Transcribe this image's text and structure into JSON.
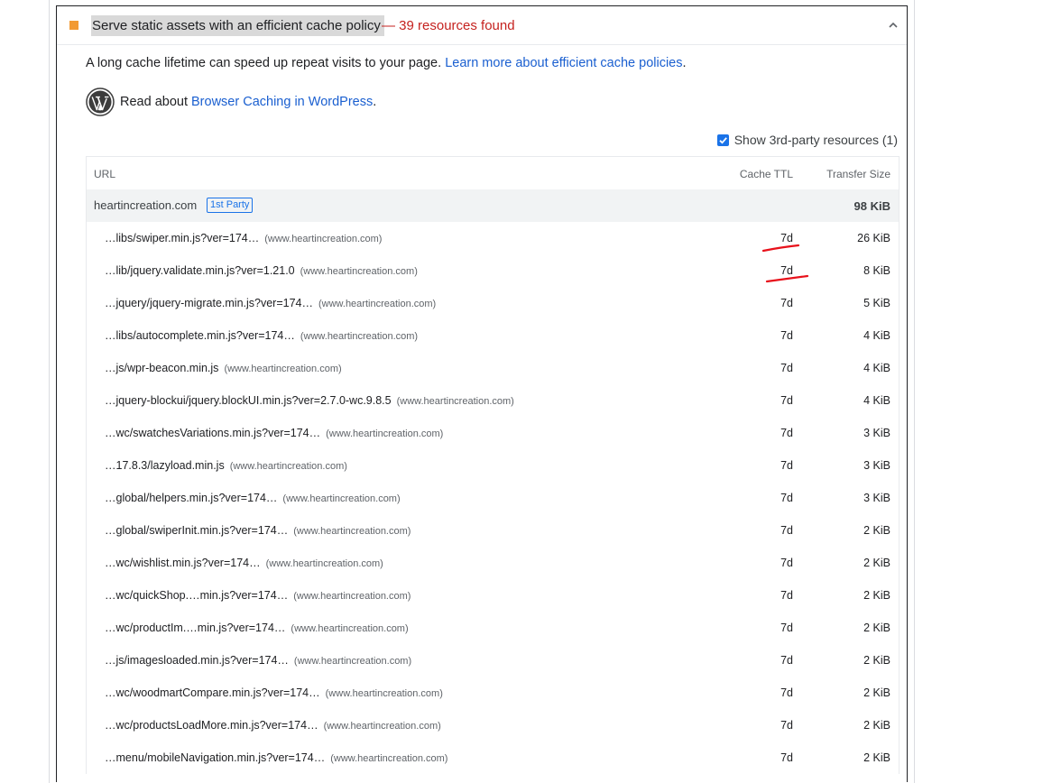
{
  "audit": {
    "title": "Serve static assets with an efficient cache policy",
    "summary": "— 39 resources found",
    "description_text": "A long cache lifetime can speed up repeat visits to your page. ",
    "description_link": "Learn more about efficient cache policies",
    "description_end": ".",
    "wp_prefix": "Read about ",
    "wp_link": "Browser Caching in WordPress",
    "wp_end": ".",
    "third_party_label": "Show 3rd-party resources (1)",
    "colors": {
      "fail": "#f29a33",
      "summary": "#c5221f",
      "link": "#1a5fd0",
      "annotation": "#e8111b"
    }
  },
  "table": {
    "headers": {
      "url": "URL",
      "ttl": "Cache TTL",
      "size": "Transfer Size"
    },
    "group": {
      "name": "heartincreation.com",
      "badge": "1st Party",
      "size": "98 KiB"
    },
    "rows": [
      {
        "url": "…libs/swiper.min.js?ver=174…",
        "host": "(www.heartincreation.com)",
        "ttl": "7d",
        "size": "26 KiB"
      },
      {
        "url": "…lib/jquery.validate.min.js?ver=1.21.0",
        "host": "(www.heartincreation.com)",
        "ttl": "7d",
        "size": "8 KiB"
      },
      {
        "url": "…jquery/jquery-migrate.min.js?ver=174…",
        "host": "(www.heartincreation.com)",
        "ttl": "7d",
        "size": "5 KiB"
      },
      {
        "url": "…libs/autocomplete.min.js?ver=174…",
        "host": "(www.heartincreation.com)",
        "ttl": "7d",
        "size": "4 KiB"
      },
      {
        "url": "…js/wpr-beacon.min.js",
        "host": "(www.heartincreation.com)",
        "ttl": "7d",
        "size": "4 KiB"
      },
      {
        "url": "…jquery-blockui/jquery.blockUI.min.js?ver=2.7.0-wc.9.8.5",
        "host": "(www.heartincreation.com)",
        "ttl": "7d",
        "size": "4 KiB"
      },
      {
        "url": "…wc/swatchesVariations.min.js?ver=174…",
        "host": "(www.heartincreation.com)",
        "ttl": "7d",
        "size": "3 KiB"
      },
      {
        "url": "…17.8.3/lazyload.min.js",
        "host": "(www.heartincreation.com)",
        "ttl": "7d",
        "size": "3 KiB"
      },
      {
        "url": "…global/helpers.min.js?ver=174…",
        "host": "(www.heartincreation.com)",
        "ttl": "7d",
        "size": "3 KiB"
      },
      {
        "url": "…global/swiperInit.min.js?ver=174…",
        "host": "(www.heartincreation.com)",
        "ttl": "7d",
        "size": "2 KiB"
      },
      {
        "url": "…wc/wishlist.min.js?ver=174…",
        "host": "(www.heartincreation.com)",
        "ttl": "7d",
        "size": "2 KiB"
      },
      {
        "url": "…wc/quickShop.…min.js?ver=174…",
        "host": "(www.heartincreation.com)",
        "ttl": "7d",
        "size": "2 KiB"
      },
      {
        "url": "…wc/productIm.…min.js?ver=174…",
        "host": "(www.heartincreation.com)",
        "ttl": "7d",
        "size": "2 KiB"
      },
      {
        "url": "…js/imagesloaded.min.js?ver=174…",
        "host": "(www.heartincreation.com)",
        "ttl": "7d",
        "size": "2 KiB"
      },
      {
        "url": "…wc/woodmartCompare.min.js?ver=174…",
        "host": "(www.heartincreation.com)",
        "ttl": "7d",
        "size": "2 KiB"
      },
      {
        "url": "…wc/productsLoadMore.min.js?ver=174…",
        "host": "(www.heartincreation.com)",
        "ttl": "7d",
        "size": "2 KiB"
      },
      {
        "url": "…menu/mobileNavigation.min.js?ver=174…",
        "host": "(www.heartincreation.com)",
        "ttl": "7d",
        "size": "2 KiB"
      }
    ]
  }
}
